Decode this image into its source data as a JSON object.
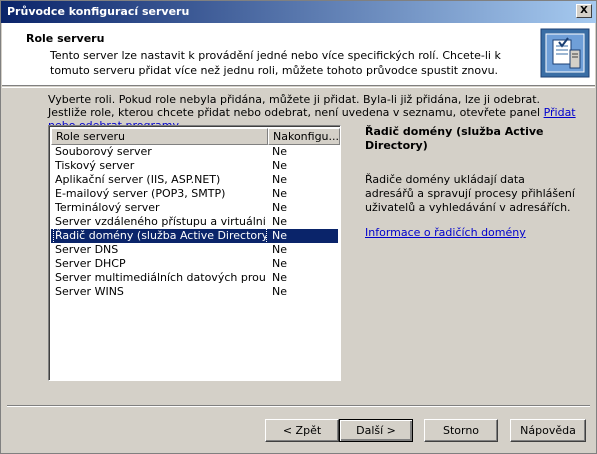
{
  "window": {
    "title": "Průvodce konfigurací serveru",
    "close_label": "X"
  },
  "header": {
    "title": "Role serveru",
    "subtitle": "Tento server lze nastavit k provádění jedné nebo více specifických rolí. Chcete-li k tomuto serveru přidat více než jednu roli, můžete tohoto průvodce spustit znovu.",
    "icon": "server-wizard-icon"
  },
  "instructions": {
    "text": "Vyberte roli. Pokud role nebyla přidána, můžete ji přidat. Byla-li již přidána, lze ji odebrat. Jestliže role, kterou chcete přidat nebo odebrat, není uvedena v seznamu, otevřete panel ",
    "link": "Přidat nebo odebrat programy",
    "suffix": "."
  },
  "list": {
    "columns": [
      "Role serveru",
      "Nakonfigu..."
    ],
    "rows": [
      {
        "name": "Souborový server",
        "status": "Ne"
      },
      {
        "name": "Tiskový server",
        "status": "Ne"
      },
      {
        "name": "Aplikační server (IIS, ASP.NET)",
        "status": "Ne"
      },
      {
        "name": "E-mailový server (POP3, SMTP)",
        "status": "Ne"
      },
      {
        "name": "Terminálový server",
        "status": "Ne"
      },
      {
        "name": "Server vzdáleného přístupu a virtuální pri...",
        "status": "Ne"
      },
      {
        "name": "Řadič domény (služba Active Directory)",
        "status": "Ne",
        "selected": true
      },
      {
        "name": "Server DNS",
        "status": "Ne"
      },
      {
        "name": "Server DHCP",
        "status": "Ne"
      },
      {
        "name": "Server multimediálních datových proudů",
        "status": "Ne"
      },
      {
        "name": "Server WINS",
        "status": "Ne"
      }
    ]
  },
  "detail": {
    "title": "Řadič domény (služba Active Directory)",
    "description": "Řadiče domény ukládají data adresářů a spravují procesy přihlášení uživatelů a vyhledávání v adresářích.",
    "link": "Informace o řadičích domény"
  },
  "buttons": {
    "back": "< Zpět",
    "next": "Další >",
    "cancel": "Storno",
    "help": "Nápověda"
  }
}
